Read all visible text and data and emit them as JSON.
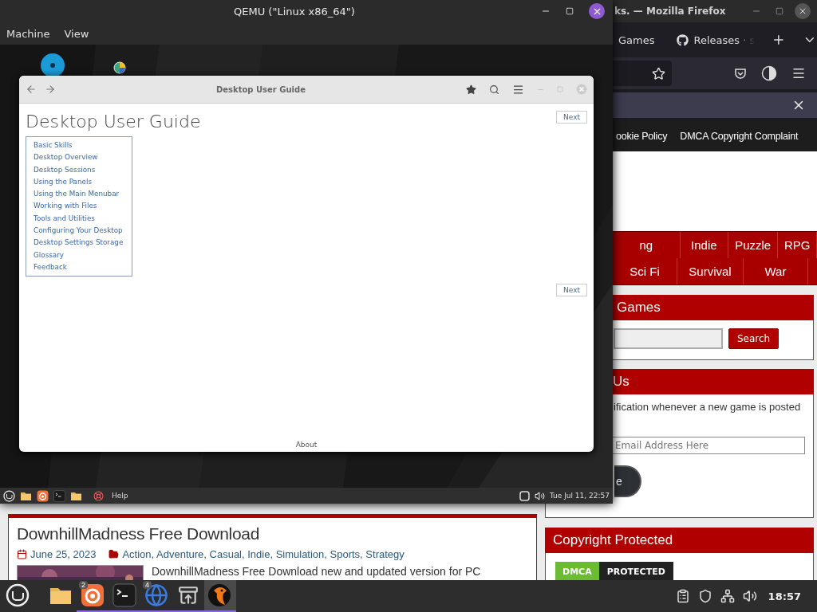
{
  "qemu": {
    "title": "QEMU (\"Linux x86_64\")",
    "menu": [
      "Machine",
      "View"
    ],
    "help_window": {
      "title": "Desktop User Guide",
      "heading": "Desktop User Guide",
      "next_top": "Next",
      "next_bottom": "Next",
      "toc": [
        "Basic Skills",
        "Desktop Overview",
        "Desktop Sessions",
        "Using the Panels",
        "Using the Main Menubar",
        "Working with Files",
        "Tools and Utilities",
        "Configuring Your Desktop",
        "Desktop Settings Storage",
        "Glossary",
        "Feedback"
      ],
      "footer": "About"
    },
    "guest_panel": {
      "help_label": "Help",
      "clock": "Tue Jul 11, 22:57"
    }
  },
  "firefox": {
    "title": "ks. — Mozilla Firefox",
    "tabs": [
      "Games",
      "Releases · s"
    ],
    "nav_links": [
      "ookie Policy",
      "DMCA Copyright Complaint"
    ],
    "categories": [
      [
        "ng",
        "Indie",
        "Puzzle",
        "RPG"
      ],
      [
        "Sci Fi",
        "Survival",
        "War"
      ]
    ],
    "search_widget": {
      "title": "Games",
      "button": "Search"
    },
    "follow_widget": {
      "title": "Us",
      "text": "ification whenever a new game is posted",
      "email_placeholder": "Email Address Here",
      "button": "e"
    },
    "post": {
      "title": "DownhillMadness Free Download",
      "date": "June 25, 2023",
      "categories": "Action, Adventure, Casual, Indie, Simulation, Sports, Strategy",
      "excerpt": "DownhillMadness Free Download new and updated version for PC"
    },
    "copyright_widget": {
      "title": "Copyright Protected",
      "badge_left": "DMCA",
      "badge_right": "PROTECTED"
    }
  },
  "taskbar": {
    "apps": [
      {
        "running": false,
        "selected": false
      },
      {
        "badge": "2",
        "running": true,
        "selected": false
      },
      {
        "running": true,
        "selected": false
      },
      {
        "badge": "4",
        "running": true,
        "selected": false
      },
      {
        "running": true,
        "selected": false
      },
      {
        "running": true,
        "selected": true
      }
    ],
    "clock": "18:57"
  }
}
